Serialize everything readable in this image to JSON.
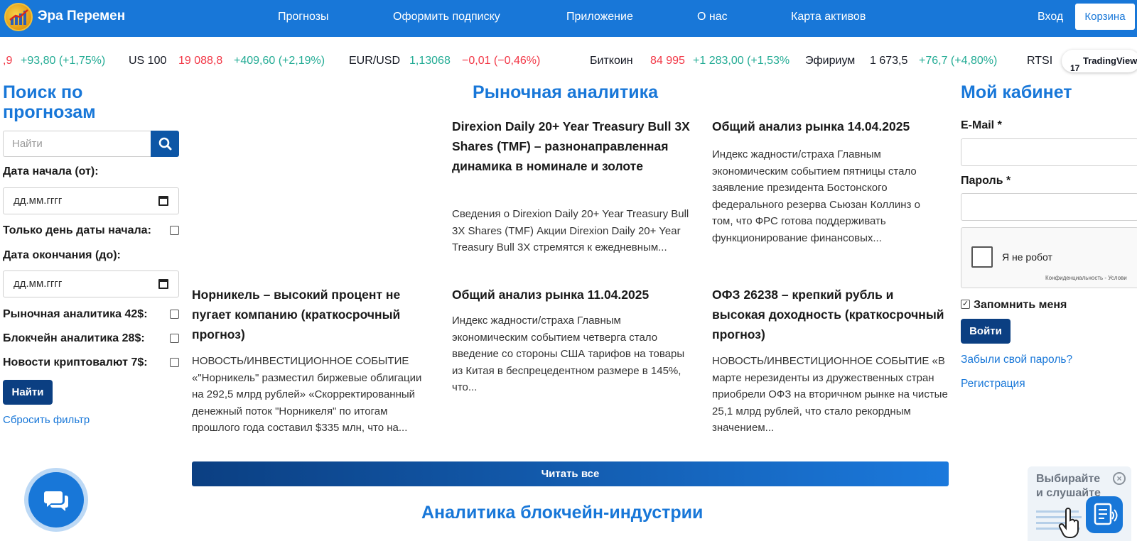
{
  "header": {
    "brand": "Эра Перемен",
    "nav": [
      "Прогнозы",
      "Оформить подписку",
      "Приложение",
      "О нас",
      "Карта активов"
    ],
    "login": "Вход",
    "cart": "Корзина"
  },
  "ticker": [
    {
      "name": "",
      "price": ",9",
      "change": "+93,80 (+1,75%)",
      "price_dir": "down",
      "change_dir": "up"
    },
    {
      "name": "US 100",
      "price": "19 088,8",
      "change": "+409,60 (+2,19%)",
      "price_dir": "down",
      "change_dir": "up"
    },
    {
      "name": "EUR/USD",
      "price": "1,13068",
      "change": "−0,01 (−0,46%)",
      "price_dir": "up",
      "change_dir": "down"
    },
    {
      "name": "Биткоин",
      "price": "84 995",
      "change": "+1 283,00 (+1,53%",
      "price_dir": "down",
      "change_dir": "up"
    },
    {
      "name": "Эфириум",
      "price": "1 673,5",
      "change": "+76,7 (+4,80%)",
      "price_dir": "neutral",
      "change_dir": "up"
    },
    {
      "name": "RTSI",
      "price": "",
      "change": "",
      "price_dir": "neutral",
      "change_dir": "neutral"
    }
  ],
  "tradingview": {
    "label": "TradingView",
    "mark": "17"
  },
  "search": {
    "title_line1": "Поиск по",
    "title_line2": "прогнозам",
    "placeholder": "Найти",
    "start_label": "Дата начала (от):",
    "date_placeholder": "дд.мм.гггг",
    "only_start_day": "Только день даты начала:",
    "end_label": "Дата окончания (до):",
    "filters": [
      "Рыночная аналитика 42$:",
      "Блокчейн аналитика 28$:",
      "Новости криптовалют 7$:"
    ],
    "find_button": "Найти",
    "reset": "Сбросить фильтр"
  },
  "market": {
    "title": "Рыночная аналитика",
    "articles": [
      {
        "title": "Direxion Daily 20+ Year Treasury Bull 3X Shares (TMF) – разнонаправленная динамика в номинале и золоте",
        "text": "Сведения о Direxion Daily 20+ Year Treasury Bull 3X Shares (TMF) Акции Direxion Daily 20+ Year Treasury Bull 3X стремятся к ежедневным..."
      },
      {
        "title": "Общий анализ рынка 14.04.2025",
        "text": "Индекс жадности/страха Главным экономическим событием пятницы стало заявление президента Бостонского федерального резерва Сьюзан Коллинз о том, что ФРС готова поддерживать функционирование финансовых..."
      },
      {
        "title": "Норникель – высокий процент не пугает компанию (краткосрочный прогноз)",
        "text": "НОВОСТЬ/ИНВЕСТИЦИОННОЕ СОБЫТИЕ «\"Норникель\" разместил биржевые облигации на 292,5 млрд рублей» «Скорректированный денежный поток \"Норникеля\" по итогам прошлого года составил $335 млн, что на..."
      },
      {
        "title": "Общий анализ рынка 11.04.2025",
        "text": "Индекс жадности/страха Главным экономическим событием четверга стало введение со стороны США тарифов на товары из Китая в беспрецедентном размере в 145%, что..."
      },
      {
        "title": "ОФЗ 26238 – крепкий рубль и высокая доходность (краткосрочный прогноз)",
        "text": "НОВОСТЬ/ИНВЕСТИЦИОННОЕ СОБЫТИЕ «В марте нерезиденты из дружественных стран приобрели ОФЗ на вторичном рынке на чистые 25,1 млрд рублей, что стало рекордным значением..."
      }
    ],
    "read_all": "Читать все"
  },
  "blockchain_title": "Аналитика блокчейн-индустрии",
  "cabinet": {
    "title": "Мой кабинет",
    "email_label": "E-Mail *",
    "password_label": "Пароль *",
    "captcha_label": "Я не робот",
    "captcha_footer": "Конфиденциальность - Услови",
    "remember": "Запомнить меня",
    "login_button": "Войти",
    "forgot": "Забыли свой пароль?",
    "register": "Регистрация"
  },
  "voice_widget": {
    "line1": "Выбирайте",
    "line2": "и слушайте"
  }
}
